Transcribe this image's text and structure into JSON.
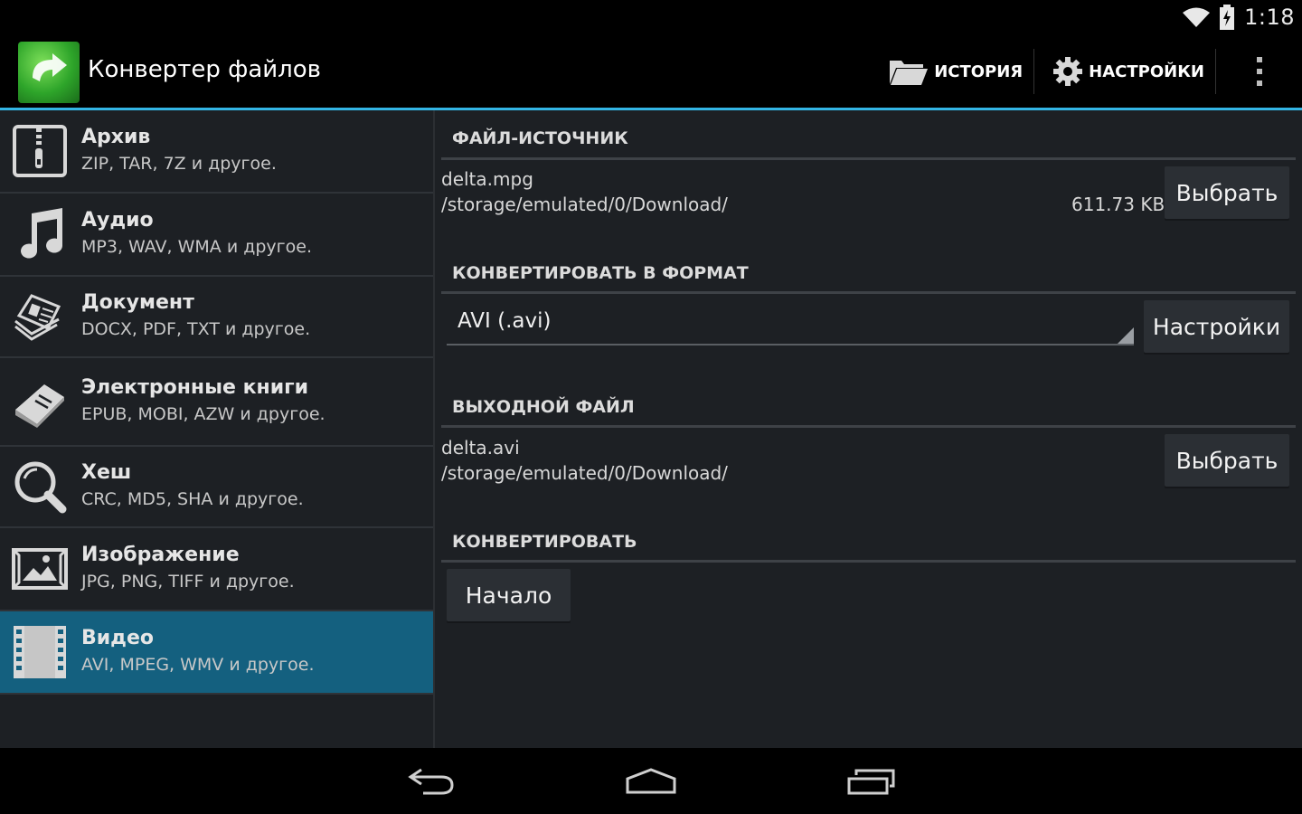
{
  "status_bar": {
    "time": "1:18",
    "icons": [
      "wifi-icon",
      "battery-charging-icon"
    ]
  },
  "action_bar": {
    "title": "Конвертер файлов",
    "history_label": "ИСТОРИЯ",
    "settings_label": "НАСТРОЙКИ",
    "icons": [
      "app-logo-icon",
      "folder-icon",
      "gear-icon",
      "overflow-menu-icon"
    ],
    "accent_color": "#33b5e5"
  },
  "categories": [
    {
      "title": "Архив",
      "subtitle": "ZIP, TAR, 7Z и другое.",
      "icon": "archive-icon"
    },
    {
      "title": "Аудио",
      "subtitle": "MP3, WAV, WMA и другое.",
      "icon": "music-note-icon"
    },
    {
      "title": "Документ",
      "subtitle": "DOCX, PDF, TXT и другое.",
      "icon": "document-icon"
    },
    {
      "title": "Электронные книги",
      "subtitle": "EPUB, MOBI, AZW и другое.",
      "icon": "book-icon"
    },
    {
      "title": "Хеш",
      "subtitle": "CRC, MD5, SHA и другое.",
      "icon": "magnifier-icon"
    },
    {
      "title": "Изображение",
      "subtitle": "JPG, PNG, TIFF и другое.",
      "icon": "image-icon"
    },
    {
      "title": "Видео",
      "subtitle": "AVI, MPEG, WMV и другое.",
      "icon": "film-icon",
      "selected": true
    }
  ],
  "selected_color": "#14607f",
  "source": {
    "header": "ФАЙЛ-ИСТОЧНИК",
    "file_name": "delta.mpg",
    "path": "/storage/emulated/0/Download/",
    "size": "611.73 KB",
    "choose_label": "Выбрать"
  },
  "format": {
    "header": "КОНВЕРТИРОВАТЬ В ФОРМАТ",
    "selected": "AVI (.avi)",
    "settings_label": "Настройки"
  },
  "output": {
    "header": "ВЫХОДНОЙ ФАЙЛ",
    "file_name": "delta.avi",
    "path": "/storage/emulated/0/Download/",
    "choose_label": "Выбрать"
  },
  "convert": {
    "header": "КОНВЕРТИРОВАТЬ",
    "start_label": "Начало"
  },
  "nav_bar": {
    "icons": [
      "back-icon",
      "home-icon",
      "recents-icon"
    ]
  }
}
